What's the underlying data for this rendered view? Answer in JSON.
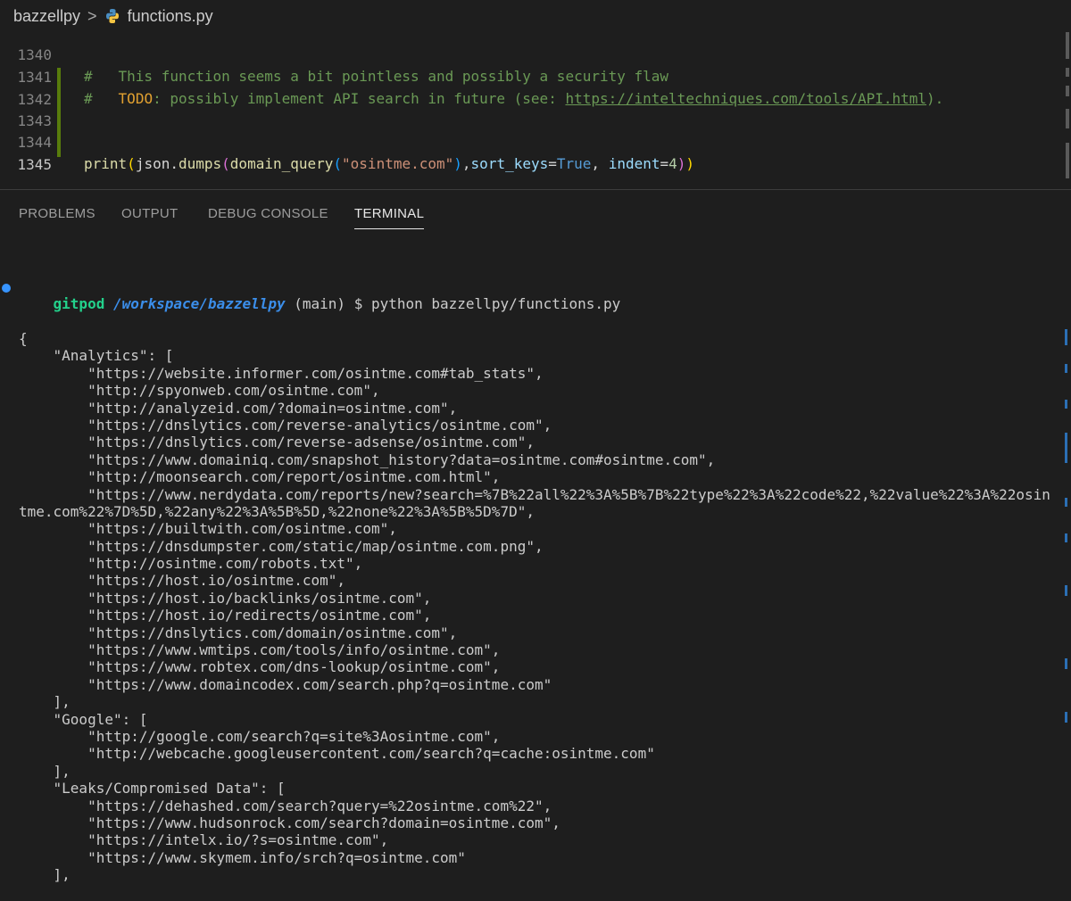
{
  "breadcrumb": {
    "folder": "bazzellpy",
    "separator": ">",
    "file": "functions.py"
  },
  "editor": {
    "lines": [
      {
        "num": "1340",
        "text": "#   This function seems a bit pointless and possibly a security flaw"
      },
      {
        "num": "1341",
        "hash": "#",
        "todo": "TODO",
        "text": ": possibly implement API search in future (see: ",
        "url": "https://inteltechniques.com/tools/API.html",
        "end": ")."
      },
      {
        "num": "1342"
      },
      {
        "num": "1343"
      },
      {
        "num": "1344",
        "fn1": "print",
        "mod": "json.",
        "fn2": "dumps",
        "fn3": "domain_query",
        "str": "\"osintme.com\"",
        "p1": "sort_keys",
        "kw": "True",
        "p2": "indent",
        "num_val": "4"
      },
      {
        "num": "1345"
      }
    ]
  },
  "panel": {
    "tabs": [
      "PROBLEMS",
      "OUTPUT",
      "DEBUG CONSOLE",
      "TERMINAL"
    ],
    "active": "TERMINAL"
  },
  "terminal": {
    "prompt": {
      "user": "gitpod",
      "path": "/workspace/bazzellpy",
      "branch": " (main) $ ",
      "command": "python bazzellpy/functions.py"
    },
    "lines": [
      "{",
      "    \"Analytics\": [",
      "        \"https://website.informer.com/osintme.com#tab_stats\",",
      "        \"http://spyonweb.com/osintme.com\",",
      "        \"http://analyzeid.com/?domain=osintme.com\",",
      "        \"https://dnslytics.com/reverse-analytics/osintme.com\",",
      "        \"https://dnslytics.com/reverse-adsense/osintme.com\",",
      "        \"https://www.domainiq.com/snapshot_history?data=osintme.com#osintme.com\",",
      "        \"http://moonsearch.com/report/osintme.com.html\",",
      "        \"https://www.nerdydata.com/reports/new?search=%7B%22all%22%3A%5B%7B%22type%22%3A%22code%22,%22value%22%3A%22osin",
      "tme.com%22%7D%5D,%22any%22%3A%5B%5D,%22none%22%3A%5B%5D%7D\",",
      "        \"https://builtwith.com/osintme.com\",",
      "        \"https://dnsdumpster.com/static/map/osintme.com.png\",",
      "        \"http://osintme.com/robots.txt\",",
      "        \"https://host.io/osintme.com\",",
      "        \"https://host.io/backlinks/osintme.com\",",
      "        \"https://host.io/redirects/osintme.com\",",
      "        \"https://dnslytics.com/domain/osintme.com\",",
      "        \"https://www.wmtips.com/tools/info/osintme.com\",",
      "        \"https://www.robtex.com/dns-lookup/osintme.com\",",
      "        \"https://www.domaincodex.com/search.php?q=osintme.com\"",
      "    ],",
      "    \"Google\": [",
      "        \"http://google.com/search?q=site%3Aosintme.com\",",
      "        \"http://webcache.googleusercontent.com/search?q=cache:osintme.com\"",
      "    ],",
      "    \"Leaks/Compromised Data\": [",
      "        \"https://dehashed.com/search?query=%22osintme.com%22\",",
      "        \"https://www.hudsonrock.com/search?domain=osintme.com\",",
      "        \"https://intelx.io/?s=osintme.com\",",
      "        \"https://www.skymem.info/srch?q=osintme.com\"",
      "    ],"
    ]
  }
}
